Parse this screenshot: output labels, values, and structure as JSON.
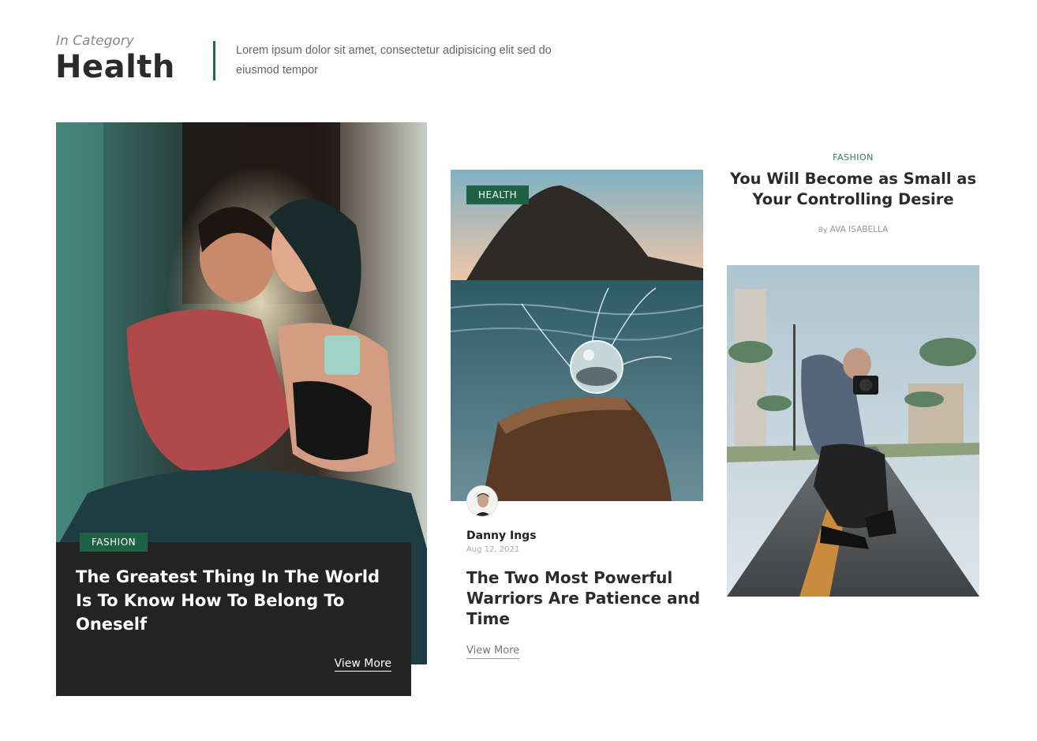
{
  "header": {
    "eyebrow": "In Category",
    "title": "Health",
    "description": "Lorem ipsum dolor sit amet, consectetur adipisicing elit sed do eiusmod tempor",
    "accent_color": "#1f6b48"
  },
  "cards": [
    {
      "category": "FASHION",
      "title": "The Greatest Thing In The World Is To Know How To Belong To Oneself",
      "link_label": "View More",
      "image": "couple-photo"
    },
    {
      "category": "HEALTH",
      "author": "Danny Ings",
      "date": "Aug 12, 2021",
      "title": "The Two Most Powerful Warriors Are Patience and Time",
      "link_label": "View More",
      "image": "crystal-ball-seascape-photo"
    },
    {
      "category": "FASHION",
      "title": "You Will Become as Small as Your Controlling Desire",
      "byline_prefix": "By",
      "byline_author": "AVA ISABELLA",
      "image": "photographer-on-road-photo"
    }
  ],
  "colors": {
    "tag_background": "#1e6145",
    "dark_panel": "#232323"
  }
}
